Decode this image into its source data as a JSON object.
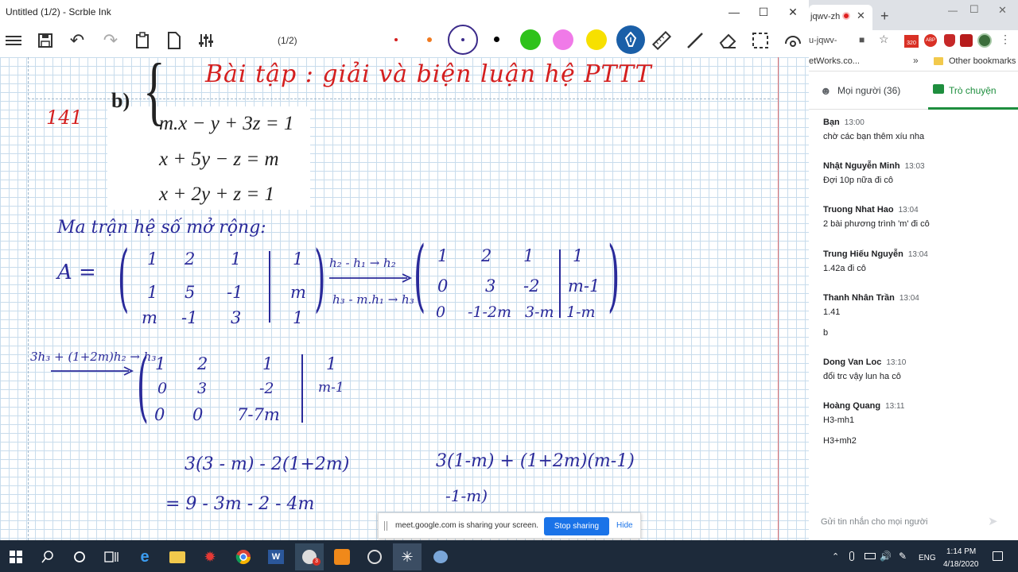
{
  "window": {
    "title": "Untitled (1/2) - Scrble Ink"
  },
  "toolbar": {
    "page_indicator": "(1/2)"
  },
  "colors": {
    "swatches": [
      "#d41f1f",
      "#f07a20",
      "#3b2a8a",
      "#000000",
      "#2ec21a",
      "#f07ae8",
      "#f7e000"
    ],
    "pen_active": "#1a5fa8"
  },
  "canvas": {
    "heading": "Bài tập : giải và biện luận hệ PTTT",
    "problem_number": "141",
    "equation_label": "b)",
    "equations": [
      "m.x − y + 3z = 1",
      "x + 5y − z = m",
      "x + 2y + z = 1"
    ],
    "matrix_caption": "Ma trận hệ số mở rộng:",
    "matrix_name": "A =",
    "matrix1": [
      [
        "1",
        "2",
        "1",
        "1"
      ],
      [
        "1",
        "5",
        "-1",
        "m"
      ],
      [
        "m",
        "-1",
        "3",
        "1"
      ]
    ],
    "op1_top": "h₂ - h₁ → h₂",
    "op1_bottom": "h₃ - m.h₁ → h₃",
    "matrix2": [
      [
        "1",
        "2",
        "1",
        "1"
      ],
      [
        "0",
        "3",
        "-2",
        "m-1"
      ],
      [
        "0",
        "-1-2m",
        "3-m",
        "1-m"
      ]
    ],
    "op2": "3h₃ + (1+2m)h₂ → h₃",
    "matrix3": [
      [
        "1",
        "2",
        "1",
        "1"
      ],
      [
        "0",
        "3",
        "-2",
        "m-1"
      ],
      [
        "0",
        "0",
        "7-7m",
        ""
      ]
    ],
    "calc_left_1": "3(3 - m) - 2(1+2m)",
    "calc_left_2": "= 9 - 3m - 2 - 4m",
    "calc_right_1": "3(1-m) + (1+2m)(m-1)",
    "calc_right_2": "-1-m)"
  },
  "browser": {
    "tab_title": "jqwv-zh",
    "address": "u-jqwv-",
    "bookmark_left": "etWorks.co...",
    "bookmark_more": "»",
    "bookmark_other": "Other bookmarks",
    "people_tab": "Mọi người (36)",
    "chat_tab": "Trò chuyện",
    "chat_placeholder": "Gửi tin nhắn cho mọi người",
    "messages": [
      {
        "name": "Bạn",
        "time": "13:00",
        "lines": [
          "chờ các bạn thêm xíu nha"
        ]
      },
      {
        "name": "Nhật Nguyễn Minh",
        "time": "13:03",
        "lines": [
          "Đợi 10p nữa đi cô"
        ]
      },
      {
        "name": "Truong Nhat Hao",
        "time": "13:04",
        "lines": [
          "2 bài phương trình 'm' đi cô"
        ]
      },
      {
        "name": "Trung Hiếu Nguyễn",
        "time": "13:04",
        "lines": [
          "1.42a đi cô"
        ]
      },
      {
        "name": "Thanh Nhân Trần",
        "time": "13:04",
        "lines": [
          "1.41",
          "b"
        ]
      },
      {
        "name": "Dong Van Loc",
        "time": "13:10",
        "lines": [
          "đổi trc vậy lun ha cô"
        ]
      },
      {
        "name": "Hoàng Quang",
        "time": "13:11",
        "lines": [
          "H3-mh1",
          "H3+mh2"
        ]
      }
    ],
    "badge_count": "320",
    "badge_abp": "ABP"
  },
  "sharebar": {
    "message": "meet.google.com is sharing your screen.",
    "stop": "Stop sharing",
    "hide": "Hide"
  },
  "taskbar": {
    "time": "1:14 PM",
    "date": "4/18/2020",
    "lang": "ENG",
    "chrome_badge": "3"
  }
}
